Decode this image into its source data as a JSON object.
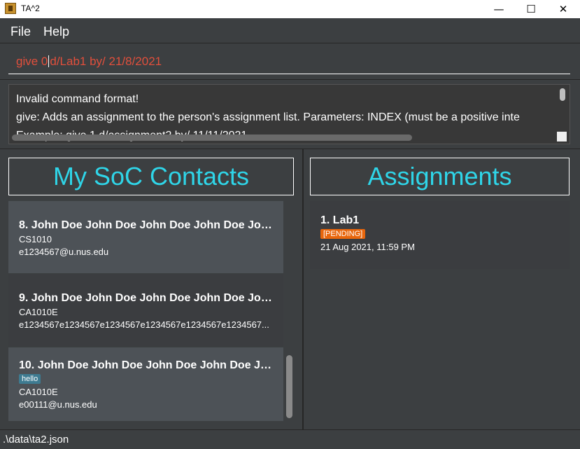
{
  "window": {
    "title": "TA^2",
    "minimize_glyph": "—",
    "maximize_glyph": "☐",
    "close_glyph": "✕"
  },
  "menu": {
    "file": "File",
    "help": "Help"
  },
  "command": {
    "before_cursor": "give 0",
    "after_cursor": "d/Lab1 by/ 21/8/2021"
  },
  "result": {
    "lines": [
      "Invalid command format!",
      "give: Adds an assignment to the person's assignment list. Parameters: INDEX (must be a positive inte",
      "Example: give 1 d/assignment2 by/ 11/11/2021"
    ]
  },
  "contacts": {
    "title": "My SoC Contacts",
    "items": [
      {
        "name": "8.  John Doe John Doe John Doe John Doe John ...",
        "module": "CS1010",
        "email": "e1234567@u.nus.edu"
      },
      {
        "name": "9.  John Doe John Doe John Doe John Doe John ...",
        "module": "CA1010E",
        "email": "e1234567e1234567e1234567e1234567e1234567e1234567..."
      },
      {
        "name": "10.  John Doe John Doe John Doe John Doe Joh...",
        "tag": "hello",
        "module": "CA1010E",
        "email": "e00111@u.nus.edu"
      }
    ]
  },
  "assignments": {
    "title": "Assignments",
    "items": [
      {
        "name": "1.  Lab1",
        "status": "[PENDING]",
        "deadline": "21 Aug 2021, 11:59 PM"
      }
    ]
  },
  "status": {
    "path": ".\\data\\ta2.json"
  },
  "colors": {
    "accent": "#2fd5e8",
    "error": "#e14f3c",
    "pending": "#e8660c",
    "tag": "#3e7b91"
  }
}
